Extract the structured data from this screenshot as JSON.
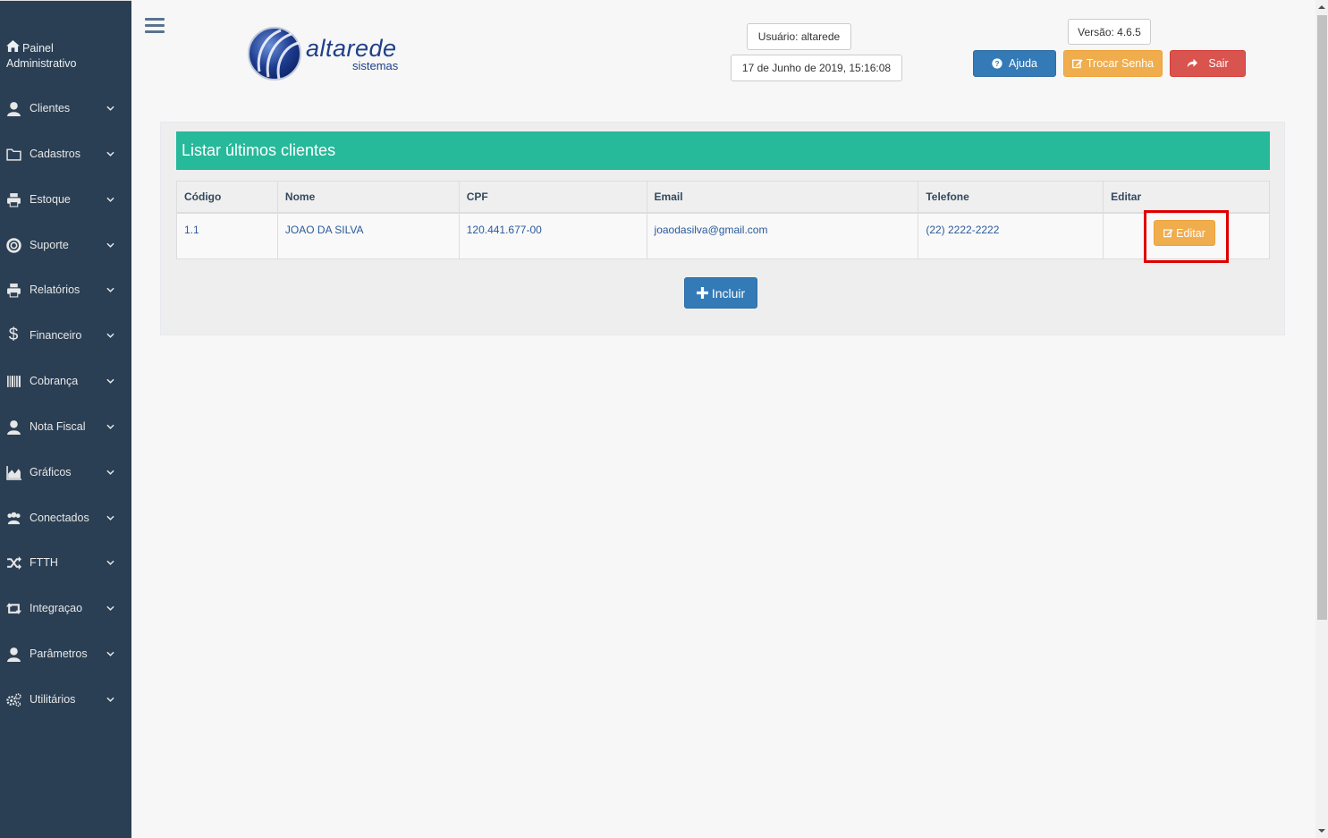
{
  "sidebar": {
    "title_line1": "Painel",
    "title_line2": "Administrativo",
    "items": [
      {
        "label": "Clientes",
        "icon": "user-icon"
      },
      {
        "label": "Cadastros",
        "icon": "folder-icon"
      },
      {
        "label": "Estoque",
        "icon": "printer-icon"
      },
      {
        "label": "Suporte",
        "icon": "life-ring-icon"
      },
      {
        "label": "Relatórios",
        "icon": "printer-icon"
      },
      {
        "label": "Financeiro",
        "icon": "dollar-icon"
      },
      {
        "label": "Cobrança",
        "icon": "barcode-icon"
      },
      {
        "label": "Nota Fiscal",
        "icon": "user-icon"
      },
      {
        "label": "Gráficos",
        "icon": "area-chart-icon"
      },
      {
        "label": "Conectados",
        "icon": "users-icon"
      },
      {
        "label": "FTTH",
        "icon": "random-icon"
      },
      {
        "label": "Integraçao",
        "icon": "retweet-icon"
      },
      {
        "label": "Parâmetros",
        "icon": "user-icon"
      },
      {
        "label": "Utilitários",
        "icon": "gears-icon"
      }
    ]
  },
  "header": {
    "logo_text": "altarede",
    "logo_sub": "sistemas",
    "user": "Usuário: altarede",
    "datetime": "17 de Junho de 2019, 15:16:08",
    "version": "Versão: 4.6.5",
    "help_label": "Ajuda",
    "change_password_label": "Trocar Senha",
    "logout_label": "Sair"
  },
  "panel": {
    "title": "Listar últimos clientes",
    "columns": [
      "Código",
      "Nome",
      "CPF",
      "Email",
      "Telefone",
      "Editar"
    ],
    "rows": [
      {
        "codigo": "1.1",
        "nome": "JOAO DA SILVA",
        "cpf": "120.441.677-00",
        "email": "joaodasilva@gmail.com",
        "telefone": "(22) 2222-2222",
        "edit_label": "Editar"
      }
    ],
    "add_label": "Incluir"
  },
  "colors": {
    "sidebar_bg": "#2a3f54",
    "title_bar": "#26b99a",
    "primary": "#337ab7",
    "warning": "#f0ad4e",
    "danger": "#d9534f",
    "highlight": "#e00000"
  }
}
